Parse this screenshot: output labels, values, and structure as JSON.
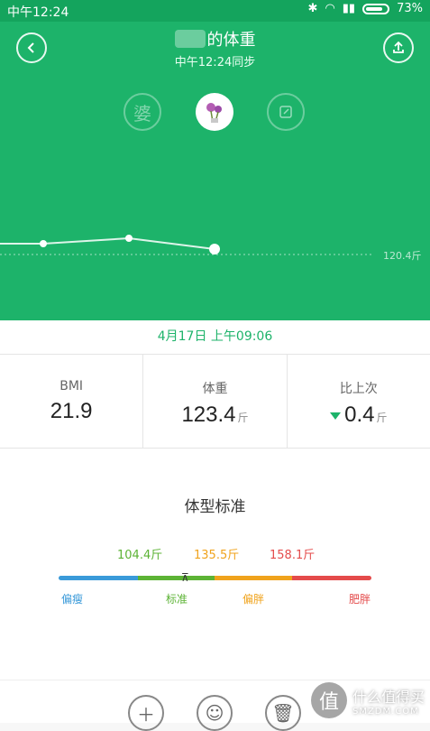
{
  "status_bar": {
    "time": "中午12:24",
    "battery": "73%"
  },
  "header": {
    "title": "的体重",
    "subtitle": "中午12:24同步"
  },
  "avatars": {
    "left_char": "婆"
  },
  "chart_data": {
    "type": "line",
    "x": [
      1,
      2,
      3
    ],
    "values": [
      120.6,
      120.7,
      120.5
    ],
    "reference_line": "120.4斤"
  },
  "date_label": "4月17日 上午09:06",
  "stats": {
    "bmi_label": "BMI",
    "bmi_value": "21.9",
    "weight_label": "体重",
    "weight_value": "123.4",
    "weight_unit": "斤",
    "change_label": "比上次",
    "change_value": "0.4",
    "change_unit": "斤"
  },
  "body_type": {
    "title": "体型标准",
    "thresholds": [
      "104.4斤",
      "135.5斤",
      "158.1斤"
    ],
    "categories": [
      "偏瘦",
      "标准",
      "偏胖",
      "肥胖"
    ],
    "colors": [
      "#3a9ad9",
      "#5cb335",
      "#f0a31c",
      "#e44b4b"
    ]
  },
  "watermark": {
    "cn": "什么值得买",
    "en": "SMZDM.COM",
    "logo_char": "值"
  }
}
